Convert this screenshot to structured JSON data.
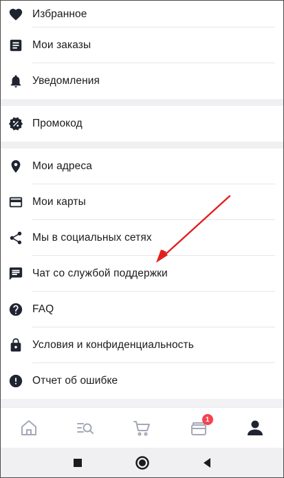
{
  "menu": {
    "group1": [
      {
        "label": "Избранное",
        "icon": "heart-icon"
      },
      {
        "label": "Мои заказы",
        "icon": "orders-icon"
      },
      {
        "label": "Уведомления",
        "icon": "bell-icon"
      }
    ],
    "group2": [
      {
        "label": "Промокод",
        "icon": "promo-badge-icon"
      }
    ],
    "group3": [
      {
        "label": "Мои адреса",
        "icon": "location-pin-icon"
      },
      {
        "label": "Мои карты",
        "icon": "credit-card-icon"
      },
      {
        "label": "Мы в социальных сетях",
        "icon": "share-icon"
      },
      {
        "label": "Чат со службой поддержки",
        "icon": "chat-icon"
      },
      {
        "label": "FAQ",
        "icon": "help-icon"
      },
      {
        "label": "Условия и конфиденциальность",
        "icon": "lock-icon"
      },
      {
        "label": "Отчет об ошибке",
        "icon": "error-icon"
      }
    ]
  },
  "tabbar": {
    "tabs": [
      {
        "name": "home",
        "icon": "home-icon",
        "active": false
      },
      {
        "name": "search",
        "icon": "search-list-icon",
        "active": false
      },
      {
        "name": "cart",
        "icon": "cart-icon",
        "active": false
      },
      {
        "name": "coupons",
        "icon": "coupons-icon",
        "active": false,
        "badge": "1"
      },
      {
        "name": "profile",
        "icon": "profile-icon",
        "active": true
      }
    ]
  },
  "colors": {
    "icon": "#1f2430",
    "inactive_tab": "#a4a8b6",
    "badge": "#f4434f",
    "annotation_arrow": "#e0201e"
  }
}
